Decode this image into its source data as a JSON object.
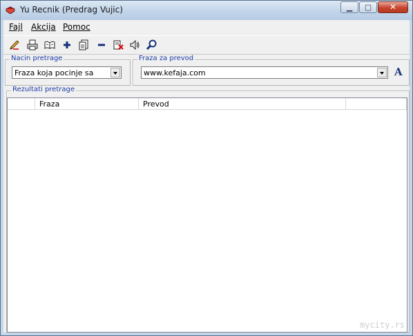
{
  "window": {
    "title": "Yu Recnik (Predrag Vujic)"
  },
  "menu": {
    "items": [
      "Fajl",
      "Akcija",
      "Pomoc"
    ]
  },
  "toolbar": {
    "buttons": [
      "edit-pen-icon",
      "print-icon",
      "dictionary-book-icon",
      "add-plus-icon",
      "import-document-icon",
      "remove-minus-icon",
      "delete-document-icon",
      "speaker-icon",
      "search-magnifier-icon"
    ]
  },
  "search_mode": {
    "label": "Nacin pretrage",
    "value": "Fraza koja pocinje sa"
  },
  "phrase": {
    "label": "Fraza za prevod",
    "value": "www.kefaja.com",
    "font_button": "A"
  },
  "results": {
    "label": "Rezultati pretrage",
    "columns": [
      "",
      "Fraza",
      "Prevod",
      ""
    ]
  },
  "watermark": "mycity.rs"
}
